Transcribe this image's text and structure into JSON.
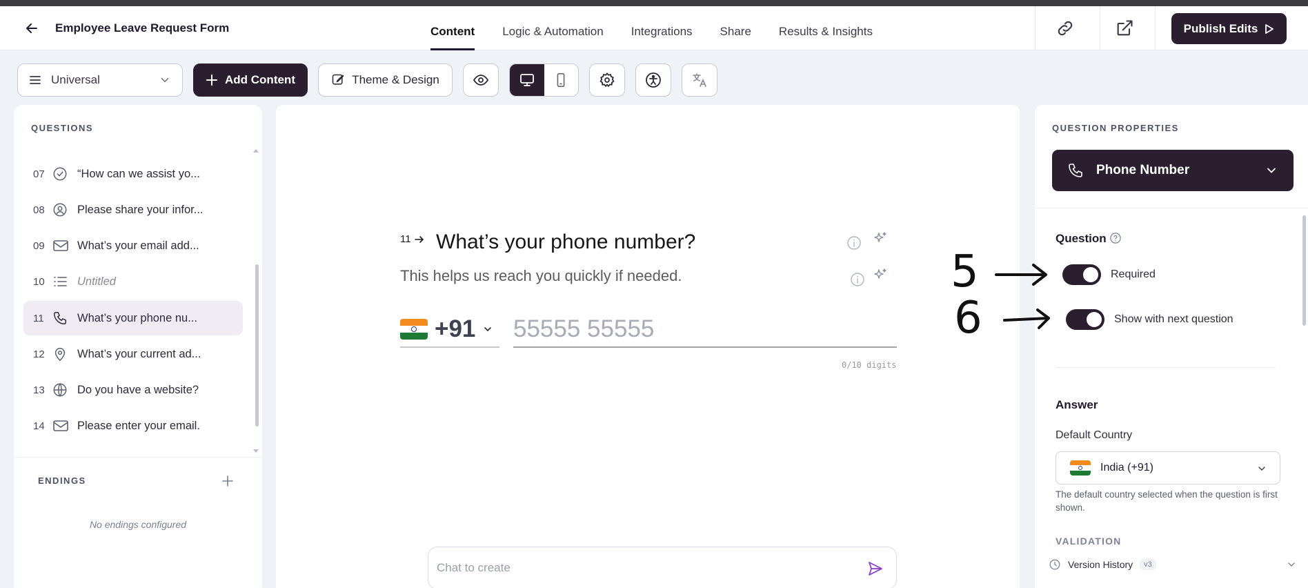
{
  "header": {
    "form_title": "Employee Leave Request Form",
    "tabs": [
      {
        "label": "Content",
        "active": true
      },
      {
        "label": "Logic & Automation"
      },
      {
        "label": "Integrations"
      },
      {
        "label": "Share"
      },
      {
        "label": "Results & Insights"
      }
    ],
    "publish_label": "Publish Edits"
  },
  "toolbar": {
    "view_select": "Universal",
    "add_content": "Add Content",
    "theme_design": "Theme & Design"
  },
  "questions_panel": {
    "title": "QUESTIONS",
    "items": [
      {
        "num": "07",
        "icon": "check-circle-icon",
        "text": "“How can we assist yo..."
      },
      {
        "num": "08",
        "icon": "user-circle-icon",
        "text": "Please share your infor..."
      },
      {
        "num": "09",
        "icon": "mail-icon",
        "text": "What’s your email add..."
      },
      {
        "num": "10",
        "icon": "list-icon",
        "text": "Untitled"
      },
      {
        "num": "11",
        "icon": "phone-icon",
        "text": "What’s your phone nu...",
        "selected": true
      },
      {
        "num": "12",
        "icon": "location-pin-icon",
        "text": "What’s your current ad..."
      },
      {
        "num": "13",
        "icon": "globe-icon",
        "text": "Do you have a website?"
      },
      {
        "num": "14",
        "icon": "mail-icon",
        "text": "Please enter your email."
      }
    ],
    "endings_title": "ENDINGS",
    "no_endings": "No endings configured"
  },
  "canvas": {
    "question_number": "11",
    "question_title": "What’s your phone number?",
    "question_subtitle": "This helps us reach you quickly if needed.",
    "country_code": "+91",
    "phone_placeholder": "55555 55555",
    "digit_counter": "0/10 digits",
    "chat_placeholder": "Chat to create"
  },
  "properties_panel": {
    "title": "QUESTION PROPERTIES",
    "question_type": "Phone Number",
    "question_section": "Question",
    "required_label": "Required",
    "required_on": true,
    "show_next_label": "Show with next question",
    "show_next_on": true,
    "answer_section": "Answer",
    "default_country_label": "Default Country",
    "default_country_value": "India (+91)",
    "default_country_help": "The default country selected when the question is first shown.",
    "validation_label": "VALIDATION",
    "version_history": "Version History",
    "version_badge": "v3"
  },
  "annotations": {
    "marker_5": "5",
    "marker_6": "6"
  },
  "colors": {
    "primary_dark": "#2b1e2f",
    "background": "#eff2f7",
    "selected_item_bg": "#f1ecf4",
    "send_icon": "#8b3fd6"
  }
}
